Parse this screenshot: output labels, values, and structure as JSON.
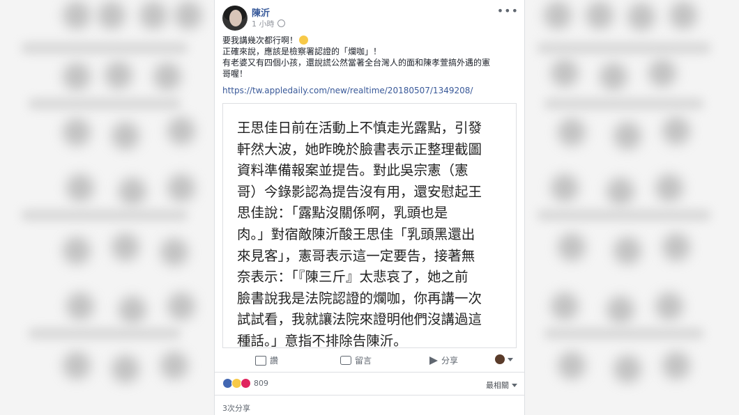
{
  "post": {
    "author": "陳沂",
    "time": "1 小時",
    "more": "•••",
    "lines": [
      "要我講幾次都行啊！",
      "正確來說，應該是檢察署認證的「爛咖」！",
      "有老婆又有四個小孩，還說謊公然當著全台灣人的面和陳孝萱搞外遇的憲",
      "哥喔！"
    ],
    "link": "https://tw.appledaily.com/new/realtime/20180507/1349208/"
  },
  "quote": {
    "lines": [
      "王思佳日前在活動上不慎走光露點，引發",
      "軒然大波，她昨晚於臉書表示正整理截圖",
      "資料準備報案並提告。對此吳宗憲（憲",
      "哥）今錄影認為提告沒有用，還安慰起王",
      "思佳說：「露點沒關係啊，乳頭也是",
      "肉。」對宿敵陳沂酸王思佳「乳頭黑還出",
      "來見客」，憲哥表示這一定要告，接著無",
      "奈表示：「『陳三斤』太悲哀了，她之前",
      "臉書說我是法院認證的爛咖，你再講一次",
      "試試看，我就讓法院來證明他們沒講過這",
      "種話。」意指不排除告陳沂。"
    ]
  },
  "actions": {
    "like": "讚",
    "comment": "留言",
    "share": "分享"
  },
  "reactions": {
    "count": "809",
    "sort": "最相關",
    "shares": "3次分享"
  }
}
